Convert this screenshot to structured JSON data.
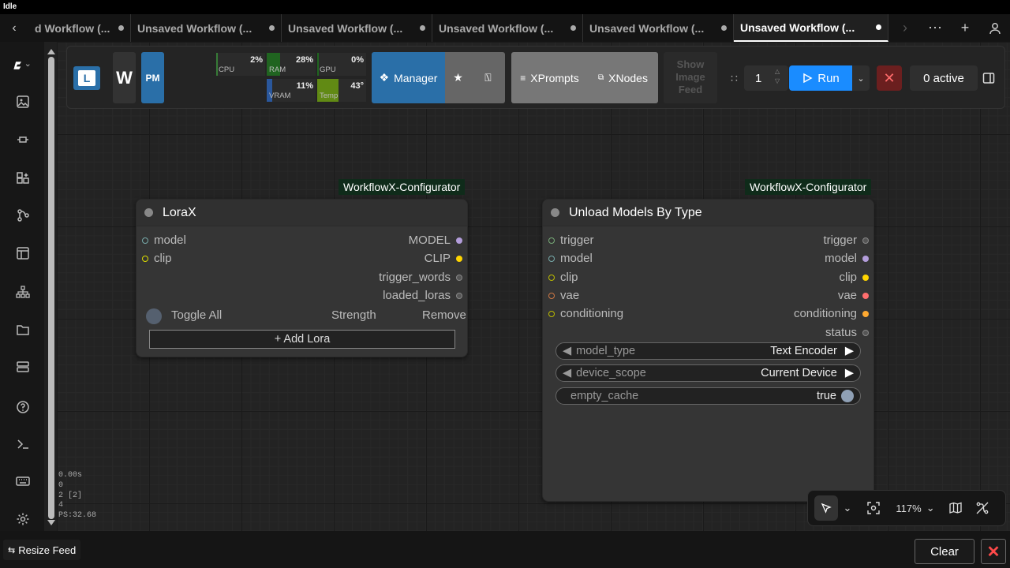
{
  "window": {
    "status": "Idle"
  },
  "tabs": [
    {
      "label": "d Workflow (..."
    },
    {
      "label": "Unsaved Workflow (..."
    },
    {
      "label": "Unsaved Workflow (..."
    },
    {
      "label": "Unsaved Workflow (..."
    },
    {
      "label": "Unsaved Workflow (..."
    },
    {
      "label": "Unsaved Workflow (..."
    }
  ],
  "toolbar": {
    "logo_letter": "L",
    "w_letter": "W",
    "pm_label": "PM",
    "monitor": {
      "cpu": {
        "label": "CPU",
        "value": "2%",
        "level": 0.02,
        "color": "#3a8a3a"
      },
      "ram": {
        "label": "RAM",
        "value": "28%",
        "level": 0.28,
        "color": "#1f6f1f"
      },
      "gpu": {
        "label": "GPU",
        "value": "0%",
        "level": 0.0,
        "color": "#1f6f1f"
      },
      "vram": {
        "label": "VRAM",
        "value": "11%",
        "level": 0.11,
        "color": "#2a5fb0"
      },
      "temp": {
        "label": "Temp",
        "value": "43°",
        "level": 0.43,
        "color": "#6b9b10"
      }
    },
    "manager_label": "Manager",
    "xprompts_label": "XPrompts",
    "xnodes_label": "XNodes",
    "image_feed_label": "Show Image Feed",
    "queue_count": "1",
    "run_label": "Run",
    "active_label": "0 active"
  },
  "nodes": {
    "lorax": {
      "badge": "WorkflowX-Configurator",
      "title": "LoraX",
      "inputs": [
        "model",
        "clip"
      ],
      "outputs": [
        "MODEL",
        "CLIP",
        "trigger_words",
        "loaded_loras"
      ],
      "toggle_all": "Toggle All",
      "strength": "Strength",
      "remove": "Remove",
      "add_lora": "+ Add Lora"
    },
    "unload": {
      "badge": "WorkflowX-Configurator",
      "title": "Unload Models By Type",
      "inputs": [
        "trigger",
        "model",
        "clip",
        "vae",
        "conditioning"
      ],
      "outputs": [
        "trigger",
        "model",
        "clip",
        "vae",
        "conditioning",
        "status"
      ],
      "widgets": {
        "model_type": {
          "name": "model_type",
          "value": "Text Encoder"
        },
        "device_scope": {
          "name": "device_scope",
          "value": "Current Device"
        },
        "empty_cache": {
          "name": "empty_cache",
          "value": "true"
        }
      }
    }
  },
  "stats": [
    "0.00s",
    "0",
    "2 [2]",
    "4",
    "PS:32.68"
  ],
  "canvas_controls": {
    "zoom": "117%"
  },
  "bottom": {
    "resize_feed": "Resize Feed",
    "clear": "Clear"
  },
  "colors": {
    "run_blue": "#1a8cff",
    "manager_blue": "#2a6fa8",
    "slot_model": "#b39ddb",
    "slot_clip": "#ffd500",
    "slot_vae": "#ff6e6e",
    "slot_conditioning": "#ffa931",
    "slot_generic": "#666"
  }
}
